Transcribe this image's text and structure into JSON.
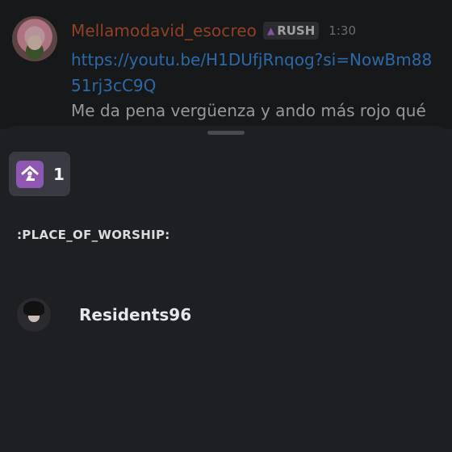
{
  "message": {
    "username": "Mellamodavid_esocreo",
    "username_color": "#c1572c",
    "tag": {
      "icon": "flame-icon",
      "label": "RUSH"
    },
    "time": "1:30",
    "link": "https://youtu.be/H1DUfjRnqog?si=NowBm8851rj3cC9Q",
    "text": "Me da pena vergüenza y ando más rojo qué"
  },
  "reactions_sheet": {
    "reaction": {
      "emoji": "place-of-worship-icon",
      "count": "1"
    },
    "emoji_name": ":PLACE_OF_WORSHIP:",
    "users": [
      {
        "name": "Residents96"
      }
    ]
  },
  "colors": {
    "background": "#1f2023",
    "sheet": "#1e1f23",
    "chip": "#3a3b42",
    "link": "#3b8de0",
    "emoji_tile": "#8e58b2"
  }
}
